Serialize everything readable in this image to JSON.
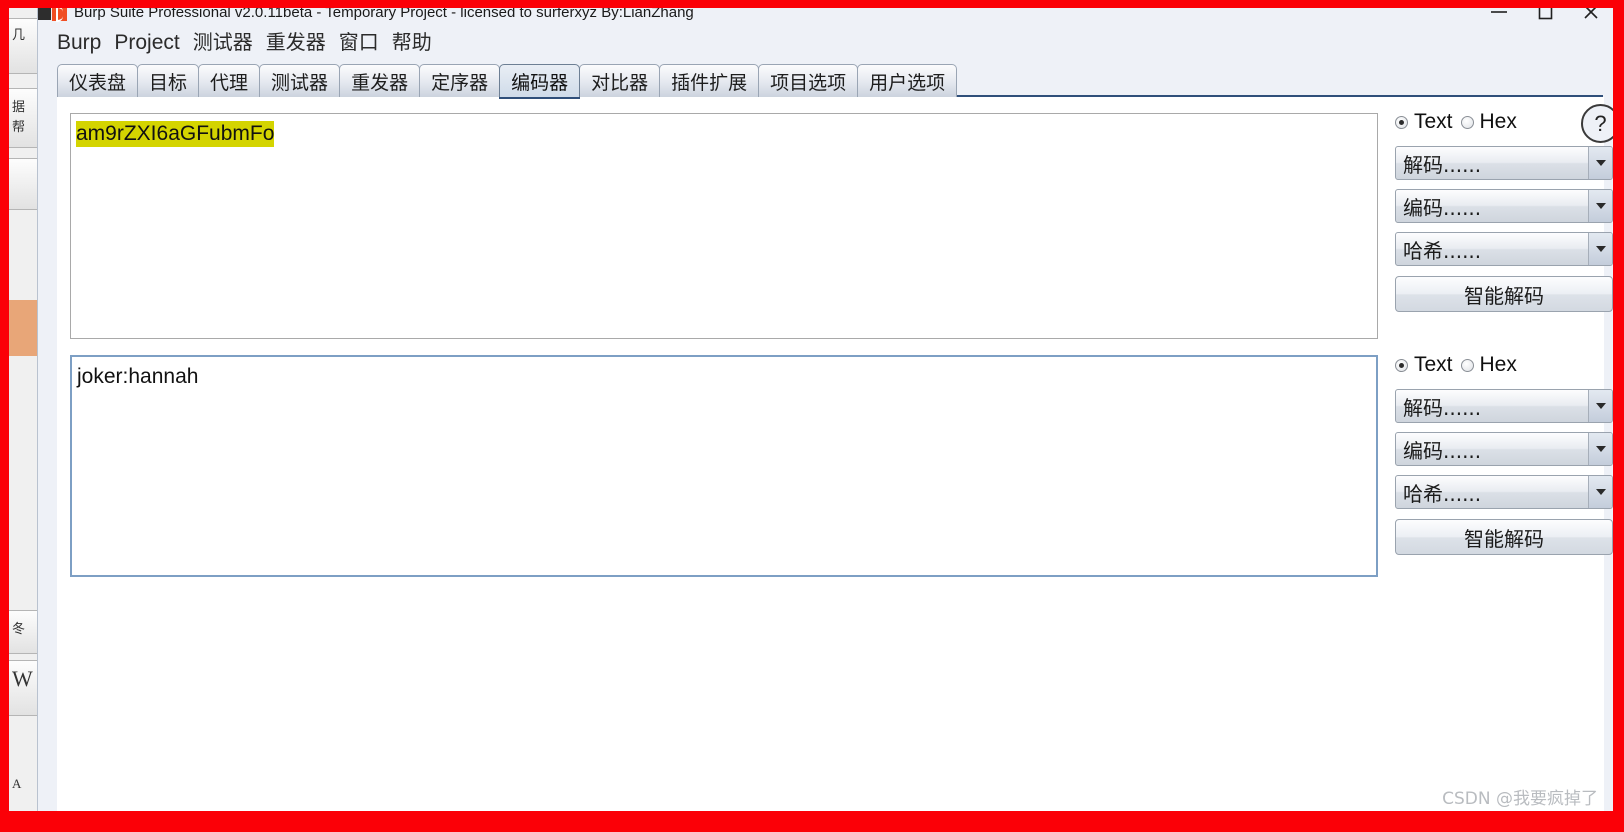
{
  "window": {
    "title": "Burp Suite Professional v2.0.11beta - Temporary Project - licensed to surferxyz By:LianZhang",
    "minimize_label": "minimize",
    "maximize_label": "maximize",
    "close_label": "close"
  },
  "menubar": {
    "items": [
      {
        "label": "Burp",
        "cjk": false
      },
      {
        "label": "Project",
        "cjk": false
      },
      {
        "label": "测试器",
        "cjk": true
      },
      {
        "label": "重发器",
        "cjk": true
      },
      {
        "label": "窗口",
        "cjk": true
      },
      {
        "label": "帮助",
        "cjk": true
      }
    ]
  },
  "tabs": {
    "items": [
      {
        "label": "仪表盘",
        "selected": false
      },
      {
        "label": "目标",
        "selected": false
      },
      {
        "label": "代理",
        "selected": false
      },
      {
        "label": "测试器",
        "selected": false
      },
      {
        "label": "重发器",
        "selected": false
      },
      {
        "label": "定序器",
        "selected": false
      },
      {
        "label": "编码器",
        "selected": true
      },
      {
        "label": "对比器",
        "selected": false
      },
      {
        "label": "插件扩展",
        "selected": false
      },
      {
        "label": "项目选项",
        "selected": false
      },
      {
        "label": "用户选项",
        "selected": false
      }
    ]
  },
  "encoder": {
    "input_panel": {
      "text": "am9rZXI6aGFubmFo",
      "highlighted": true,
      "highlight_color": "#d4d400"
    },
    "output_panel": {
      "text": "joker:hannah",
      "focused": true,
      "focus_border_color": "#7d9fc4"
    },
    "controls_top": {
      "radio_text": "Text",
      "radio_hex": "Hex",
      "selected_radio": "Text",
      "help_label": "?",
      "decode_label": "解码......",
      "encode_label": "编码......",
      "hash_label": "哈希......",
      "smart_decode_label": "智能解码"
    },
    "controls_bottom": {
      "radio_text": "Text",
      "radio_hex": "Hex",
      "selected_radio": "Text",
      "decode_label": "解码......",
      "encode_label": "编码......",
      "hash_label": "哈希......",
      "smart_decode_label": "智能解码"
    }
  },
  "watermark": {
    "text": "CSDN @我要疯掉了"
  },
  "colors": {
    "annotation_frame": "#fb0007",
    "tab_selected_underline": "#2f4f7a",
    "highlight": "#d4d400",
    "focus_border": "#7d9fc4"
  }
}
